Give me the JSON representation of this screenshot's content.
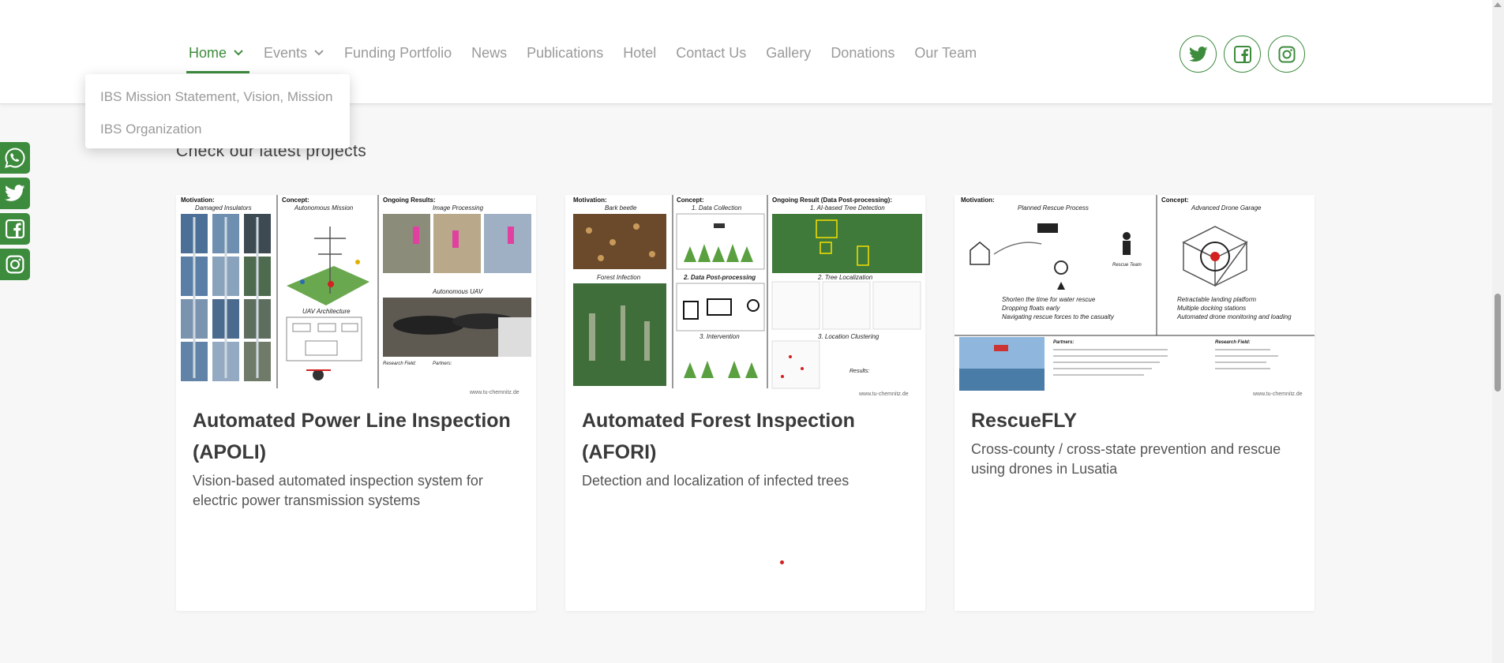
{
  "nav": {
    "items": [
      {
        "label": "Home"
      },
      {
        "label": "Events"
      },
      {
        "label": "Funding Portfolio"
      },
      {
        "label": "News"
      },
      {
        "label": "Publications"
      },
      {
        "label": "Hotel"
      },
      {
        "label": "Contact Us"
      },
      {
        "label": "Gallery"
      },
      {
        "label": "Donations"
      },
      {
        "label": "Our Team"
      }
    ]
  },
  "dropdown": {
    "items": [
      {
        "label": "IBS Mission Statement, Vision, Mission"
      },
      {
        "label": "IBS Organization"
      }
    ]
  },
  "social_top": [
    "twitter-icon",
    "facebook-icon",
    "instagram-icon"
  ],
  "side_social": [
    "whatsapp-icon",
    "twitter-icon",
    "facebook-icon",
    "instagram-icon"
  ],
  "section": {
    "heading": "Check our latest projects"
  },
  "cards": [
    {
      "title": "Automated Power Line Inspection (APOLI)",
      "description": "Vision-based automated inspection system for electric power transmission systems",
      "image": {
        "headings": [
          "Motivation:",
          "Concept:",
          "Ongoing Results:"
        ],
        "labels": [
          "Damaged Insulators",
          "Autonomous Mission",
          "Image Processing",
          "UAV Architecture",
          "Autonomous UAV",
          "Research Field:",
          "Partners:"
        ],
        "footer": "www.tu-chemnitz.de"
      }
    },
    {
      "title": "Automated Forest Inspection (AFORI)",
      "description": "Detection and localization of infected trees",
      "image": {
        "headings": [
          "Motivation:",
          "Concept:",
          "Ongoing Result (Data Post-processing):"
        ],
        "labels": [
          "Bark beetle",
          "1. Data Collection",
          "1. AI-based Tree Detection",
          "Forest Infection",
          "2. Data Post-processing",
          "2. Tree Localization",
          "3. Intervention",
          "3. Location Clustering",
          "Results:"
        ],
        "footer": "www.tu-chemnitz.de"
      }
    },
    {
      "title": "RescueFLY",
      "description": "Cross-county / cross-state prevention and rescue using drones in Lusatia",
      "image": {
        "headings": [
          "Motivation:",
          "Concept:"
        ],
        "labels": [
          "Planned Rescue Process",
          "Advanced Drone Garage",
          "Rescue Team",
          "Shorten the time for water rescue",
          "Dropping floats early",
          "Navigating rescue forces to the casualty",
          "Retractable landing platform",
          "Multiple docking stations",
          "Automated drone monitoring and loading",
          "Partners:",
          "Research Field:"
        ],
        "footer": "www.tu-chemnitz.de"
      }
    }
  ],
  "colors": {
    "accent": "#3d8b3d",
    "background": "#f7f7f7"
  }
}
